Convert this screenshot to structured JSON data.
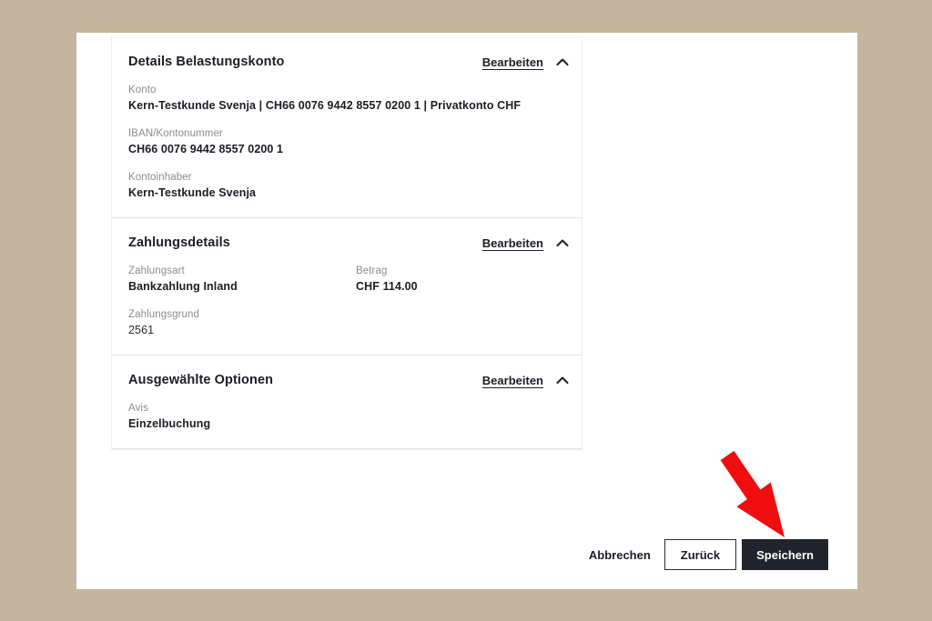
{
  "card": {
    "sections": [
      {
        "title": "Details Belastungskonto",
        "edit_label": "Bearbeiten",
        "chevron_icon": "chevron-up",
        "fields": [
          {
            "label": "Konto",
            "value": "Kern-Testkunde Svenja | CH66 0076 9442 8557 0200 1 | Privatkonto CHF"
          },
          {
            "label": "IBAN/Kontonummer",
            "value": "CH66 0076 9442 8557 0200 1"
          },
          {
            "label": "Kontoinhaber",
            "value": "Kern-Testkunde Svenja"
          }
        ]
      },
      {
        "title": "Zahlungsdetails",
        "edit_label": "Bearbeiten",
        "chevron_icon": "chevron-up",
        "fields": [
          {
            "label": "Zahlungsart",
            "value": "Bankzahlung Inland"
          },
          {
            "label": "Betrag",
            "value": "CHF 114.00"
          },
          {
            "label": "Zahlungsgrund",
            "value": "2561"
          }
        ]
      },
      {
        "title": "Ausgewählte Optionen",
        "edit_label": "Bearbeiten",
        "chevron_icon": "chevron-up",
        "fields": [
          {
            "label": "Avis",
            "value": "Einzelbuchung"
          }
        ]
      }
    ],
    "footer": {
      "cancel_label": "Abbrechen",
      "back_label": "Zurück",
      "save_label": "Speichern"
    }
  },
  "annotation": {
    "type": "red-arrow",
    "points_to": "save-button",
    "color": "#ee0e0e"
  },
  "colors": {
    "page_background": "#c4b59e",
    "card_background": "#ffffff",
    "text_primary": "#1c1e26",
    "text_label": "#8b8b8b",
    "divider": "#e4e4e4",
    "button_dark": "#22242d",
    "arrow_red": "#ee0e0e"
  }
}
